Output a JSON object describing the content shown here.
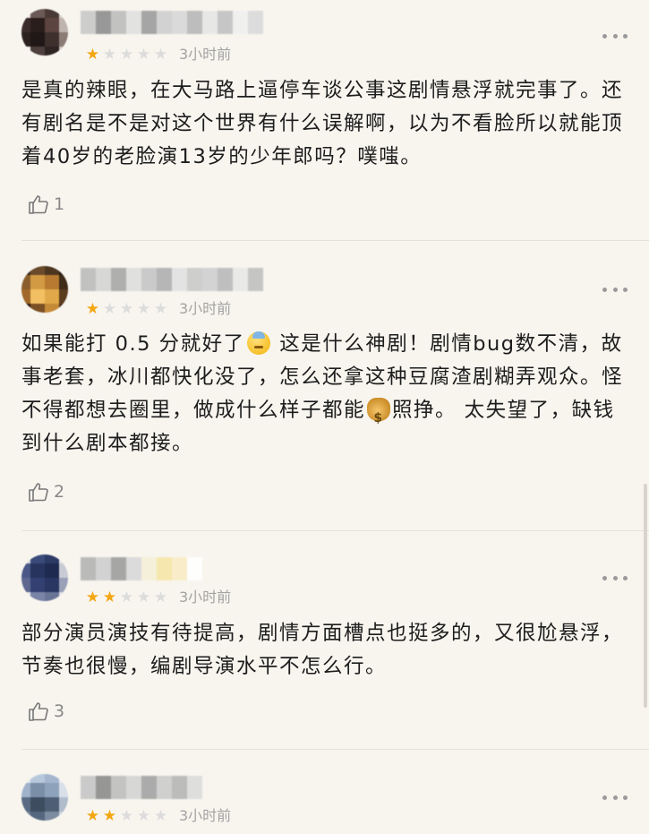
{
  "reviews": [
    {
      "rating": 1,
      "time": "3小时前",
      "text": "是真的辣眼，在大马路上逼停车谈公事这剧情悬浮就完事了。还有剧名是不是对这个世界有什么误解啊，以为不看脸所以就能顶着40岁的老脸演13岁的少年郎吗？噗嗤。",
      "likes": "1",
      "avatar_colors": [
        "#e8e4e0",
        "#6b5a55",
        "#4a3a36",
        "#d9d1cc",
        "#3a2c2a",
        "#2a1e1c",
        "#5c4440",
        "#bfb4ae",
        "#2b2220",
        "#1f1816",
        "#3d302d",
        "#8c7c76",
        "#f1eeeb",
        "#4d3f3b",
        "#2e2422",
        "#c9c0bb"
      ],
      "name_colors": [
        "#c9c9c9",
        "#8f8f8f",
        "#bdbdbd",
        "#e0e0e0",
        "#9d9d9d",
        "#cfcfcf",
        "#d8d8d8",
        "#b8b8b8",
        "#e6e6e6",
        "#c2c2c2",
        "#f0f0f0",
        "#dadada"
      ]
    },
    {
      "rating": 1,
      "time": "3小时前",
      "text_parts": [
        "如果能打 0.5 分就好了",
        "这是什么神剧！剧情bug数不清，故事老套，冰川都快化没了，怎么还拿这种豆腐渣剧糊弄观众。怪不得都想去圈里，做成什么样子都能",
        "照挣。 太失望了，缺钱到什么剧本都接。"
      ],
      "emoji_1": "sweat-emoji",
      "emoji_2": "money-bag-emoji",
      "likes": "2",
      "avatar_colors": [
        "#3b2a1c",
        "#6a4a2a",
        "#4d3620",
        "#2a1d12",
        "#8a5e2c",
        "#d39a44",
        "#b77a30",
        "#3e2b18",
        "#a0682a",
        "#f2c063",
        "#e0a848",
        "#5a3c1e",
        "#2a1b10",
        "#7a5024",
        "#c48a38",
        "#4a3018"
      ],
      "name_colors": [
        "#bcbcbc",
        "#d4d4d4",
        "#a8a8a8",
        "#dedede",
        "#c6c6c6",
        "#b0b0b0",
        "#e2e2e2",
        "#cacaca",
        "#d0d0d0",
        "#bababa",
        "#e8e8e8",
        "#c0c0c0"
      ]
    },
    {
      "rating": 2,
      "time": "3小时前",
      "text": "部分演员演技有待提高，剧情方面槽点也挺多的，又很尬悬浮，节奏也很慢，编剧导演水平不怎么行。",
      "likes": "3",
      "avatar_colors": [
        "#d8d8dc",
        "#3a4a7a",
        "#2c3a66",
        "#e4e4e8",
        "#4a5888",
        "#26345e",
        "#1e2a50",
        "#c8cad4",
        "#5e6890",
        "#324072",
        "#2a3662",
        "#9aa0b8",
        "#e6e6ea",
        "#7a84a6",
        "#6a7496",
        "#dcdde3"
      ],
      "name_colors": [
        "#b4b4b4",
        "#cfcfcf",
        "#9e9e9e",
        "#d9d9d9",
        "#f4f0d8",
        "#f6e6a8",
        "#f8edc4",
        "#ffffff"
      ]
    },
    {
      "rating": 2,
      "time": "3小时前",
      "likes": "",
      "avatar_colors": [
        "#e2e6ec",
        "#b8c8dc",
        "#a4b6ce",
        "#e8ecf0",
        "#9fb2ca",
        "#7a8ea8",
        "#8ea2bc",
        "#d8dfe8",
        "#5a6c84",
        "#3e4c60",
        "#4e5e74",
        "#b0bccb",
        "#6a7a90",
        "#55677e",
        "#7d8ca0",
        "#c6cfda"
      ],
      "name_colors": [
        "#c6c6c6",
        "#8c8c8c",
        "#bebebe",
        "#d4d4d4",
        "#a4a4a4",
        "#cccccc",
        "#b6b6b6",
        "#dcdcdc"
      ]
    }
  ],
  "icons": {
    "more": "more-dots-icon",
    "like": "thumbs-up-icon",
    "star_on": "star-filled-icon",
    "star_off": "star-empty-icon"
  },
  "colors": {
    "background": "#f8f5ef",
    "star_on": "#f3a712",
    "star_off": "#dcdcdc",
    "muted": "#a3a3a3"
  }
}
